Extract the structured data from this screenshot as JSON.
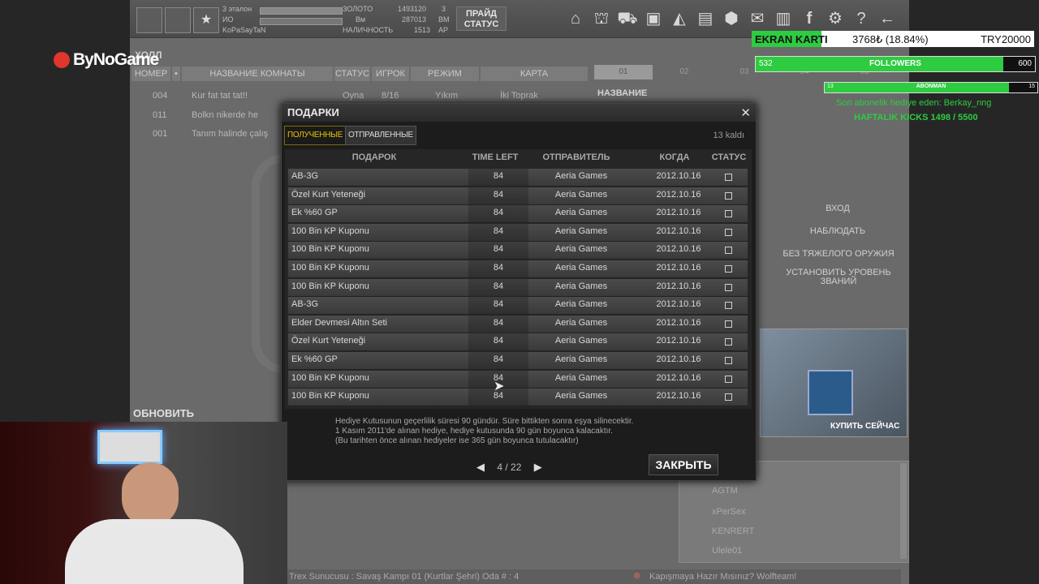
{
  "brand": {
    "logo_text": "ByNoGame"
  },
  "top_overlay": {
    "ekran_label": "EKRAN KARTI",
    "ekran_value": "3768₺ (18.84%)",
    "ekran_goal": "TRY20000",
    "ekran_progress": 0.1884,
    "followers_count": "532",
    "followers_label": "FOLLOWERS",
    "followers_goal": "600",
    "followers_progress": 0.887,
    "abonman_count": "13",
    "abonman_label": "ABONMAN",
    "abonman_goal": "15",
    "abonman_progress": 0.867,
    "last_sub_text": "Son abonelik hediye eden: Berkay_nng",
    "kicks_text": "HAFTALIK KICKS 1498 / 5500",
    "colors": {
      "green": "#2ecc40",
      "dark": "#111111"
    }
  },
  "game": {
    "player": {
      "name": "KoPaSayTaN",
      "rank_label": "3 эталон",
      "io_label": "ИО"
    },
    "currency": {
      "gold_label": "ЗОЛОТО",
      "gold_value": "1493120",
      "gold_count": "3",
      "bm_label": "ВМ",
      "bm_value": "287013",
      "bm_count": "3",
      "ap_label": "АР",
      "ap_value": "1513",
      "name_label": "НАЛИЧНОСТЬ",
      "bm_label2": "Вм"
    },
    "status_button": "ПРАЙД СТАТУС",
    "hall_label": "ХОЛЛ",
    "lobby_headers": [
      "НОМЕР",
      "НАЗВАНИЕ КОМНАТЫ",
      "СТАТУС",
      "ИГРОК",
      "РЕЖИМ",
      "КАРТА"
    ],
    "lobby_rows": [
      {
        "num": "004",
        "name": "Kur fat tat tat!!",
        "status": "Oyna",
        "players": "8/16",
        "mode": "Yıkım",
        "map": "İki Toprak"
      },
      {
        "num": "011",
        "name": "Bolkn nikerde he",
        "status": "",
        "players": "",
        "mode": "",
        "map": ""
      },
      {
        "num": "001",
        "name": "Tanım halinde çalış",
        "status": "",
        "players": "",
        "mode": "",
        "map": ""
      }
    ],
    "right_tabs": [
      "01",
      "02",
      "03",
      "04",
      "05"
    ],
    "right_panel_title": "НАЗВАНИЕ",
    "right_menu": [
      "ВХОД",
      "НАБЛЮДАТЬ",
      "БЕЗ ТЯЖЕЛОГО ОРУЖИЯ",
      "УСТАНОВИТЬ УРОВЕНЬ ЗВАНИЙ"
    ],
    "buy_label": "КУПИТЬ СЕЙЧАС",
    "refresh_label": "ОБНОВИТЬ",
    "friends": [
      "AGTM",
      "xPerSex",
      "KENRERT",
      "Ulele01"
    ],
    "chat_left": "Trex Sunucusu : Savaş Kampı 01 (Kurtlar Şehri) Oda # : 4",
    "chat_right": "Kapışmaya Hazır Mısınız? Wolfteam!"
  },
  "dialog": {
    "title": "ПОДАРКИ",
    "tab_received": "ПОЛУЧЕННЫЕ",
    "tab_sent": "ОТПРАВЛЕННЫЕ",
    "remaining": "13 kaldı",
    "headers": {
      "gift": "ПОДАРОК",
      "time_left": "TIME LEFT",
      "sender": "ОТПРАВИТЕЛЬ",
      "when": "КОГДА",
      "status": "СТАТУС"
    },
    "rows": [
      {
        "gift": "AB-3G",
        "time": "84",
        "sender": "Aeria Games",
        "date": "2012.10.16"
      },
      {
        "gift": "Özel Kurt Yeteneği",
        "time": "84",
        "sender": "Aeria Games",
        "date": "2012.10.16"
      },
      {
        "gift": "Ek %60 GP",
        "time": "84",
        "sender": "Aeria Games",
        "date": "2012.10.16"
      },
      {
        "gift": "100 Bin KP Kuponu",
        "time": "84",
        "sender": "Aeria Games",
        "date": "2012.10.16"
      },
      {
        "gift": "100 Bin KP Kuponu",
        "time": "84",
        "sender": "Aeria Games",
        "date": "2012.10.16"
      },
      {
        "gift": "100 Bin KP Kuponu",
        "time": "84",
        "sender": "Aeria Games",
        "date": "2012.10.16"
      },
      {
        "gift": "100 Bin KP Kuponu",
        "time": "84",
        "sender": "Aeria Games",
        "date": "2012.10.16"
      },
      {
        "gift": "AB-3G",
        "time": "84",
        "sender": "Aeria Games",
        "date": "2012.10.16"
      },
      {
        "gift": "Elder Devmesi Altın Seti",
        "time": "84",
        "sender": "Aeria Games",
        "date": "2012.10.16"
      },
      {
        "gift": "Özel Kurt Yeteneği",
        "time": "84",
        "sender": "Aeria Games",
        "date": "2012.10.16"
      },
      {
        "gift": "Ek %60 GP",
        "time": "84",
        "sender": "Aeria Games",
        "date": "2012.10.16"
      },
      {
        "gift": "100 Bin KP Kuponu",
        "time": "84",
        "sender": "Aeria Games",
        "date": "2012.10.16"
      },
      {
        "gift": "100 Bin KP Kuponu",
        "time": "84",
        "sender": "Aeria Games",
        "date": "2012.10.16"
      }
    ],
    "info_lines": [
      "Hediye Kutusunun geçerlilik süresi 90 gündür. Süre bittikten sonra eşya silinecektir.",
      "1 Kasım 2011'de alınan hediye, hediye kutusunda 90 gün boyunca kalacaktır.",
      "(Bu tarihten önce alınan hediyeler ise 365 gün boyunca tutulacaktır)"
    ],
    "page": "4 / 22",
    "close_button": "ЗАКРЫТЬ"
  }
}
